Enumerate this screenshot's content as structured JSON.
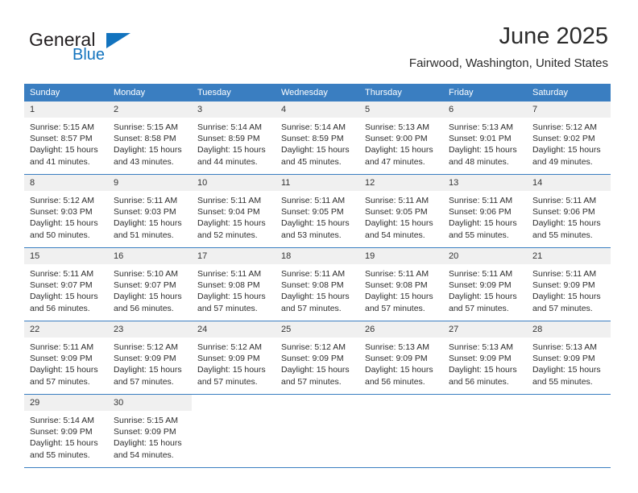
{
  "brand": {
    "word1": "General",
    "word2": "Blue",
    "accent_color": "#1273be",
    "triangle_icon": "triangle-icon"
  },
  "header": {
    "month_title": "June 2025",
    "location": "Fairwood, Washington, United States"
  },
  "theme": {
    "header_row_bg": "#3a7ec1",
    "daynum_bg": "#f0f0f0",
    "grid_line": "#3a7ec1",
    "text": "#2d2d2d"
  },
  "weekdays": [
    "Sunday",
    "Monday",
    "Tuesday",
    "Wednesday",
    "Thursday",
    "Friday",
    "Saturday"
  ],
  "weeks": [
    [
      {
        "day": "1",
        "sunrise": "Sunrise: 5:15 AM",
        "sunset": "Sunset: 8:57 PM",
        "daylight1": "Daylight: 15 hours",
        "daylight2": "and 41 minutes."
      },
      {
        "day": "2",
        "sunrise": "Sunrise: 5:15 AM",
        "sunset": "Sunset: 8:58 PM",
        "daylight1": "Daylight: 15 hours",
        "daylight2": "and 43 minutes."
      },
      {
        "day": "3",
        "sunrise": "Sunrise: 5:14 AM",
        "sunset": "Sunset: 8:59 PM",
        "daylight1": "Daylight: 15 hours",
        "daylight2": "and 44 minutes."
      },
      {
        "day": "4",
        "sunrise": "Sunrise: 5:14 AM",
        "sunset": "Sunset: 8:59 PM",
        "daylight1": "Daylight: 15 hours",
        "daylight2": "and 45 minutes."
      },
      {
        "day": "5",
        "sunrise": "Sunrise: 5:13 AM",
        "sunset": "Sunset: 9:00 PM",
        "daylight1": "Daylight: 15 hours",
        "daylight2": "and 47 minutes."
      },
      {
        "day": "6",
        "sunrise": "Sunrise: 5:13 AM",
        "sunset": "Sunset: 9:01 PM",
        "daylight1": "Daylight: 15 hours",
        "daylight2": "and 48 minutes."
      },
      {
        "day": "7",
        "sunrise": "Sunrise: 5:12 AM",
        "sunset": "Sunset: 9:02 PM",
        "daylight1": "Daylight: 15 hours",
        "daylight2": "and 49 minutes."
      }
    ],
    [
      {
        "day": "8",
        "sunrise": "Sunrise: 5:12 AM",
        "sunset": "Sunset: 9:03 PM",
        "daylight1": "Daylight: 15 hours",
        "daylight2": "and 50 minutes."
      },
      {
        "day": "9",
        "sunrise": "Sunrise: 5:11 AM",
        "sunset": "Sunset: 9:03 PM",
        "daylight1": "Daylight: 15 hours",
        "daylight2": "and 51 minutes."
      },
      {
        "day": "10",
        "sunrise": "Sunrise: 5:11 AM",
        "sunset": "Sunset: 9:04 PM",
        "daylight1": "Daylight: 15 hours",
        "daylight2": "and 52 minutes."
      },
      {
        "day": "11",
        "sunrise": "Sunrise: 5:11 AM",
        "sunset": "Sunset: 9:05 PM",
        "daylight1": "Daylight: 15 hours",
        "daylight2": "and 53 minutes."
      },
      {
        "day": "12",
        "sunrise": "Sunrise: 5:11 AM",
        "sunset": "Sunset: 9:05 PM",
        "daylight1": "Daylight: 15 hours",
        "daylight2": "and 54 minutes."
      },
      {
        "day": "13",
        "sunrise": "Sunrise: 5:11 AM",
        "sunset": "Sunset: 9:06 PM",
        "daylight1": "Daylight: 15 hours",
        "daylight2": "and 55 minutes."
      },
      {
        "day": "14",
        "sunrise": "Sunrise: 5:11 AM",
        "sunset": "Sunset: 9:06 PM",
        "daylight1": "Daylight: 15 hours",
        "daylight2": "and 55 minutes."
      }
    ],
    [
      {
        "day": "15",
        "sunrise": "Sunrise: 5:11 AM",
        "sunset": "Sunset: 9:07 PM",
        "daylight1": "Daylight: 15 hours",
        "daylight2": "and 56 minutes."
      },
      {
        "day": "16",
        "sunrise": "Sunrise: 5:10 AM",
        "sunset": "Sunset: 9:07 PM",
        "daylight1": "Daylight: 15 hours",
        "daylight2": "and 56 minutes."
      },
      {
        "day": "17",
        "sunrise": "Sunrise: 5:11 AM",
        "sunset": "Sunset: 9:08 PM",
        "daylight1": "Daylight: 15 hours",
        "daylight2": "and 57 minutes."
      },
      {
        "day": "18",
        "sunrise": "Sunrise: 5:11 AM",
        "sunset": "Sunset: 9:08 PM",
        "daylight1": "Daylight: 15 hours",
        "daylight2": "and 57 minutes."
      },
      {
        "day": "19",
        "sunrise": "Sunrise: 5:11 AM",
        "sunset": "Sunset: 9:08 PM",
        "daylight1": "Daylight: 15 hours",
        "daylight2": "and 57 minutes."
      },
      {
        "day": "20",
        "sunrise": "Sunrise: 5:11 AM",
        "sunset": "Sunset: 9:09 PM",
        "daylight1": "Daylight: 15 hours",
        "daylight2": "and 57 minutes."
      },
      {
        "day": "21",
        "sunrise": "Sunrise: 5:11 AM",
        "sunset": "Sunset: 9:09 PM",
        "daylight1": "Daylight: 15 hours",
        "daylight2": "and 57 minutes."
      }
    ],
    [
      {
        "day": "22",
        "sunrise": "Sunrise: 5:11 AM",
        "sunset": "Sunset: 9:09 PM",
        "daylight1": "Daylight: 15 hours",
        "daylight2": "and 57 minutes."
      },
      {
        "day": "23",
        "sunrise": "Sunrise: 5:12 AM",
        "sunset": "Sunset: 9:09 PM",
        "daylight1": "Daylight: 15 hours",
        "daylight2": "and 57 minutes."
      },
      {
        "day": "24",
        "sunrise": "Sunrise: 5:12 AM",
        "sunset": "Sunset: 9:09 PM",
        "daylight1": "Daylight: 15 hours",
        "daylight2": "and 57 minutes."
      },
      {
        "day": "25",
        "sunrise": "Sunrise: 5:12 AM",
        "sunset": "Sunset: 9:09 PM",
        "daylight1": "Daylight: 15 hours",
        "daylight2": "and 57 minutes."
      },
      {
        "day": "26",
        "sunrise": "Sunrise: 5:13 AM",
        "sunset": "Sunset: 9:09 PM",
        "daylight1": "Daylight: 15 hours",
        "daylight2": "and 56 minutes."
      },
      {
        "day": "27",
        "sunrise": "Sunrise: 5:13 AM",
        "sunset": "Sunset: 9:09 PM",
        "daylight1": "Daylight: 15 hours",
        "daylight2": "and 56 minutes."
      },
      {
        "day": "28",
        "sunrise": "Sunrise: 5:13 AM",
        "sunset": "Sunset: 9:09 PM",
        "daylight1": "Daylight: 15 hours",
        "daylight2": "and 55 minutes."
      }
    ],
    [
      {
        "day": "29",
        "sunrise": "Sunrise: 5:14 AM",
        "sunset": "Sunset: 9:09 PM",
        "daylight1": "Daylight: 15 hours",
        "daylight2": "and 55 minutes."
      },
      {
        "day": "30",
        "sunrise": "Sunrise: 5:15 AM",
        "sunset": "Sunset: 9:09 PM",
        "daylight1": "Daylight: 15 hours",
        "daylight2": "and 54 minutes."
      },
      {
        "day": "",
        "sunrise": "",
        "sunset": "",
        "daylight1": "",
        "daylight2": ""
      },
      {
        "day": "",
        "sunrise": "",
        "sunset": "",
        "daylight1": "",
        "daylight2": ""
      },
      {
        "day": "",
        "sunrise": "",
        "sunset": "",
        "daylight1": "",
        "daylight2": ""
      },
      {
        "day": "",
        "sunrise": "",
        "sunset": "",
        "daylight1": "",
        "daylight2": ""
      },
      {
        "day": "",
        "sunrise": "",
        "sunset": "",
        "daylight1": "",
        "daylight2": ""
      }
    ]
  ]
}
